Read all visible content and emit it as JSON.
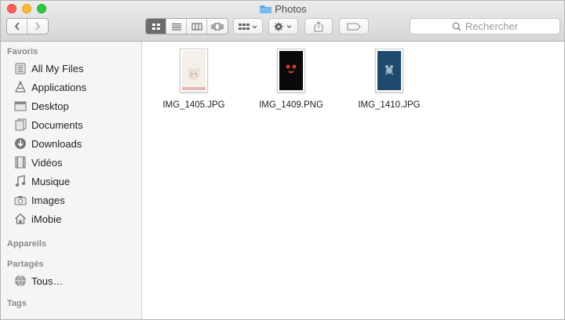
{
  "window": {
    "title": "Photos"
  },
  "toolbar": {
    "search_placeholder": "Rechercher"
  },
  "sidebar": {
    "favorites_heading": "Favoris",
    "favorites": [
      {
        "label": "All My Files",
        "icon": "all-files-icon"
      },
      {
        "label": "Applications",
        "icon": "applications-icon"
      },
      {
        "label": "Desktop",
        "icon": "desktop-icon"
      },
      {
        "label": "Documents",
        "icon": "documents-icon"
      },
      {
        "label": "Downloads",
        "icon": "downloads-icon"
      },
      {
        "label": "Vidéos",
        "icon": "film-icon"
      },
      {
        "label": "Musique",
        "icon": "music-icon"
      },
      {
        "label": "Images",
        "icon": "camera-icon"
      },
      {
        "label": "iMobie",
        "icon": "home-icon"
      }
    ],
    "devices_heading": "Appareils",
    "shared_heading": "Partagés",
    "shared": [
      {
        "label": "Tous…",
        "icon": "network-icon"
      }
    ],
    "tags_heading": "Tags"
  },
  "files": [
    {
      "name": "IMG_1405.JPG",
      "thumb_color": "#f4efe9"
    },
    {
      "name": "IMG_1409.PNG",
      "thumb_color": "#0a0a0a"
    },
    {
      "name": "IMG_1410.JPG",
      "thumb_color": "#1f4a6e"
    }
  ],
  "colors": {
    "folder": "#5aa7e6",
    "active_view": "#6b6b6b"
  }
}
